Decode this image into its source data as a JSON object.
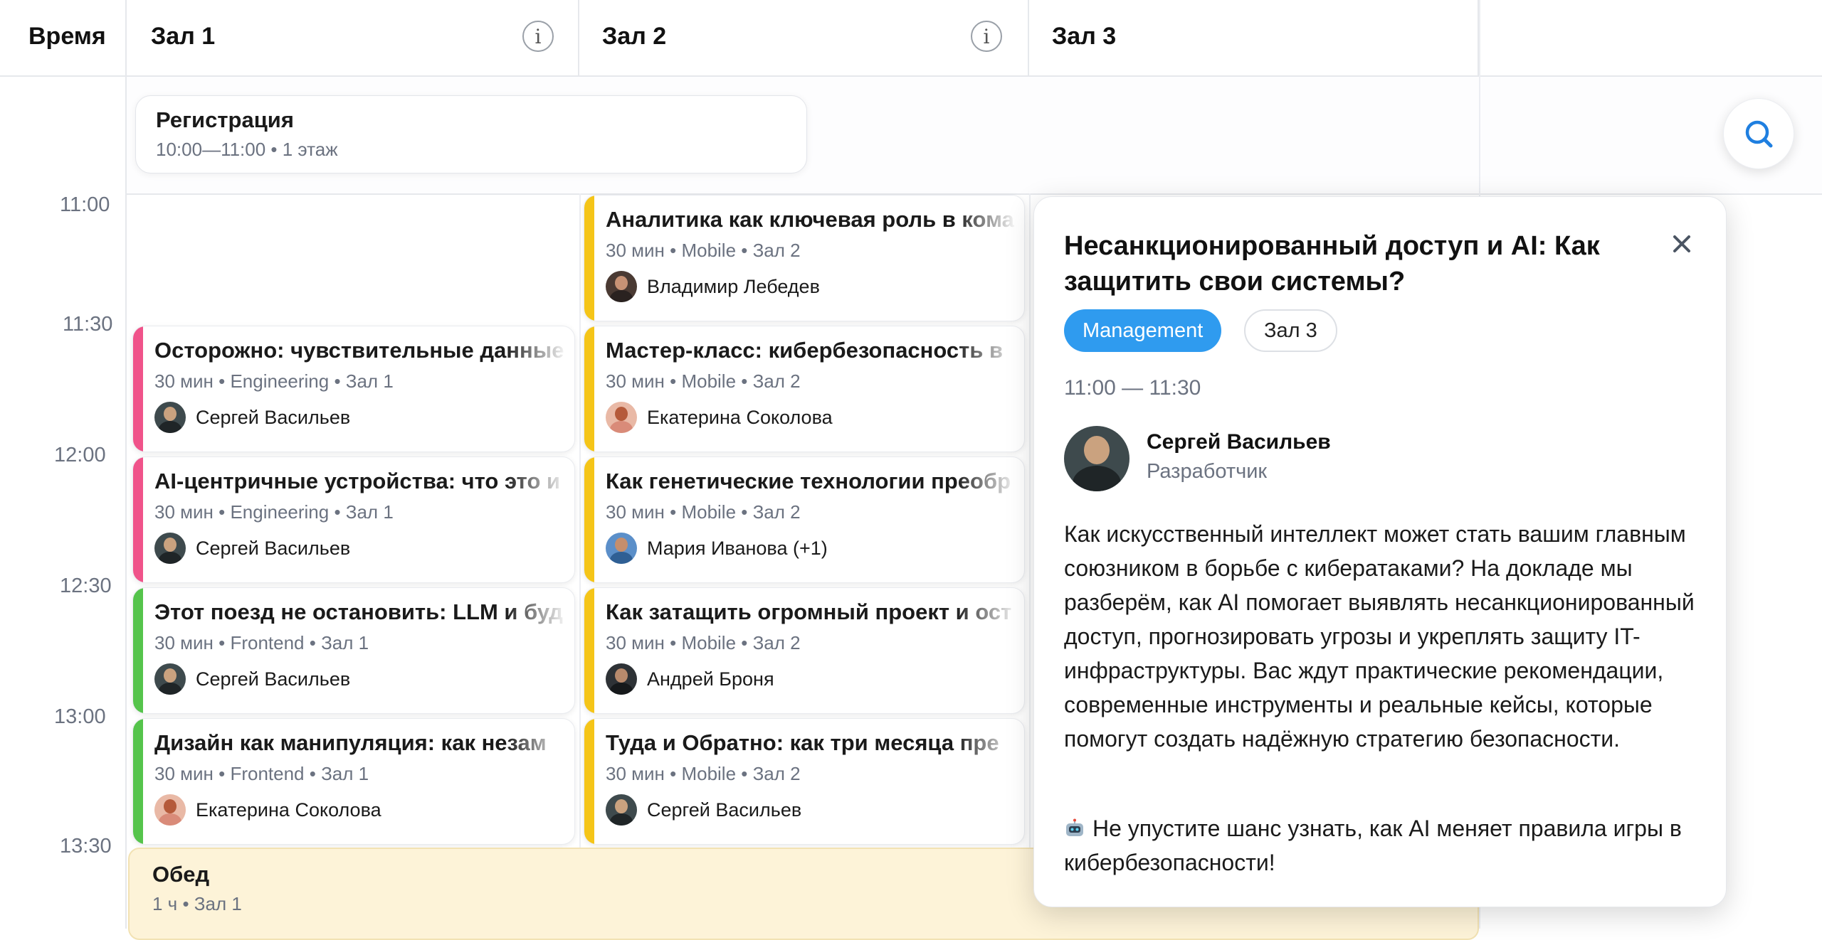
{
  "header": {
    "time_label": "Время",
    "halls": [
      "Зал 1",
      "Зал 2",
      "Зал 3"
    ]
  },
  "times": [
    "11:00",
    "11:30",
    "12:00",
    "12:30",
    "13:00",
    "13:30"
  ],
  "registration": {
    "title": "Регистрация",
    "meta": "10:00—11:00 • 1 этаж"
  },
  "hall1": [
    {
      "title": "Осторожно: чувствительные данные",
      "meta": "30 мин • Engineering • Зал 1",
      "speaker": "Сергей Васильев"
    },
    {
      "title": "AI-центричные устройства: что это и",
      "meta": "30 мин • Engineering • Зал 1",
      "speaker": "Сергей Васильев"
    },
    {
      "title": "Этот поезд не остановить: LLM и буд",
      "meta": "30 мин • Frontend • Зал 1",
      "speaker": "Сергей Васильев"
    },
    {
      "title": "Дизайн как манипуляция: как незам",
      "meta": "30 мин • Frontend • Зал 1",
      "speaker": "Екатерина Соколова"
    }
  ],
  "hall2": [
    {
      "title": "Аналитика как ключевая роль в кома",
      "meta": "30 мин • Mobile • Зал 2",
      "speaker": "Владимир Лебедев"
    },
    {
      "title": "Мастер-класс: кибербезопасность в",
      "meta": "30 мин • Mobile • Зал 2",
      "speaker": "Екатерина Соколова"
    },
    {
      "title": "Как генетические технологии преобр",
      "meta": "30 мин • Mobile • Зал 2",
      "speaker": "Мария Иванова (+1)"
    },
    {
      "title": "Как затащить огромный проект и ост",
      "meta": "30 мин • Mobile • Зал 2",
      "speaker": "Андрей Броня"
    },
    {
      "title": "Туда и Обратно: как три месяца пре",
      "meta": "30 мин • Mobile • Зал 2",
      "speaker": "Сергей Васильев"
    }
  ],
  "lunch": {
    "title": "Обед",
    "meta": "1 ч • Зал 1"
  },
  "colors": {
    "engineering": "#f0538a",
    "frontend": "#55c44b",
    "mobile": "#f5c518",
    "management": "#2f9bef",
    "accent": "#1f7fe0"
  },
  "popup": {
    "title": "Несанкционированный доступ и AI: Как защитить свои системы?",
    "chip_track": "Management",
    "chip_hall": "Зал 3",
    "time": "11:00 — 11:30",
    "speaker_name": "Сергей Васильев",
    "speaker_role": "Разработчик",
    "description": "Как искусственный интеллект может стать вашим главным союзником в борьбе с кибератаками? На докладе мы разберём, как AI помогает выявлять несанкционированный доступ, прогнозировать угрозы и укреплять защиту IT-инфраструктуры. Вас ждут практические рекомендации, современные инструменты и реальные кейсы, которые помогут создать надёжную стратегию безопасности.",
    "cta": "Не упустите шанс узнать, как AI меняет правила игры в кибербезопасности!"
  },
  "icons": {
    "close": "close-icon",
    "search": "search-icon",
    "info": "info-icon",
    "robot": "robot-icon"
  }
}
